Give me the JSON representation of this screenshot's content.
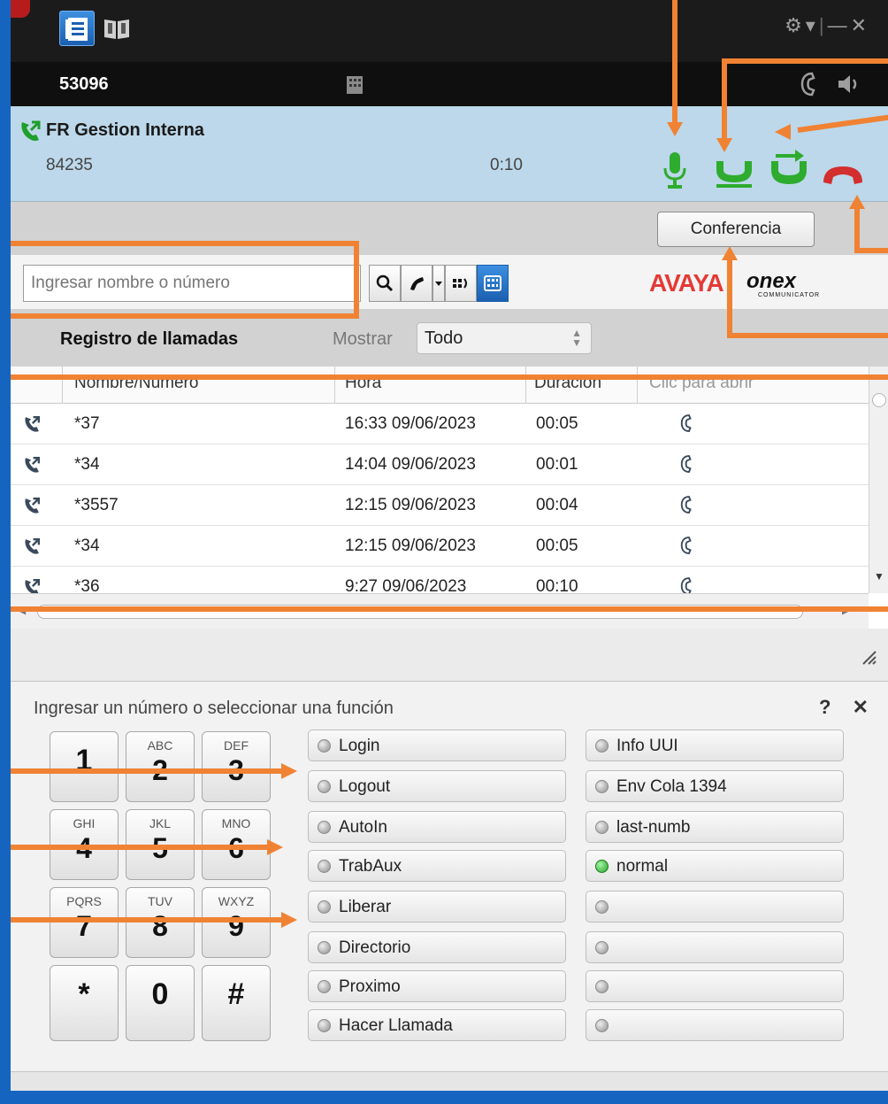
{
  "header": {
    "extension": "53096"
  },
  "active_call": {
    "name": "FR Gestion Interna",
    "number": "84235",
    "duration": "0:10",
    "conference_label": "Conferencia"
  },
  "search": {
    "placeholder": "Ingresar nombre o número"
  },
  "brand": {
    "avaya": "AVAYA",
    "onex": "onex",
    "onex_sub": "COMMUNICATOR"
  },
  "call_log": {
    "title": "Registro de llamadas",
    "show_label": "Mostrar",
    "show_value": "Todo",
    "columns": [
      "Nombre/Número",
      "Hora",
      "Duración",
      "Clic para abrir"
    ],
    "rows": [
      {
        "name": "*37",
        "time": "16:33 09/06/2023",
        "duration": "00:05"
      },
      {
        "name": "*34",
        "time": "14:04 09/06/2023",
        "duration": "00:01"
      },
      {
        "name": "*3557",
        "time": "12:15 09/06/2023",
        "duration": "00:04"
      },
      {
        "name": "*34",
        "time": "12:15 09/06/2023",
        "duration": "00:05"
      },
      {
        "name": "*36",
        "time": "9:27 09/06/2023",
        "duration": "00:10"
      }
    ]
  },
  "dialpad": {
    "prompt": "Ingresar un número o seleccionar una función",
    "help": "?",
    "keys": [
      {
        "sub": "",
        "main": "1"
      },
      {
        "sub": "ABC",
        "main": "2"
      },
      {
        "sub": "DEF",
        "main": "3"
      },
      {
        "sub": "GHI",
        "main": "4"
      },
      {
        "sub": "JKL",
        "main": "5"
      },
      {
        "sub": "MNO",
        "main": "6"
      },
      {
        "sub": "PQRS",
        "main": "7"
      },
      {
        "sub": "TUV",
        "main": "8"
      },
      {
        "sub": "WXYZ",
        "main": "9"
      },
      {
        "sub": "",
        "main": "*"
      },
      {
        "sub": "",
        "main": "0"
      },
      {
        "sub": "",
        "main": "#"
      }
    ],
    "features_left": [
      "Login",
      "Logout",
      "AutoIn",
      "TrabAux",
      "Liberar",
      "Directorio",
      "Proximo",
      "Hacer Llamada"
    ],
    "features_right": [
      "Info UUI",
      "Env Cola 1394",
      "last-numb",
      "normal",
      "",
      "",
      "",
      ""
    ],
    "features_right_on": [
      false,
      false,
      false,
      true,
      false,
      false,
      false,
      false
    ]
  },
  "colors": {
    "accent_annotation": "#f08233",
    "call_green": "#1e9e2a",
    "hangup_red": "#d32f2f",
    "window_blue": "#1565c0"
  }
}
